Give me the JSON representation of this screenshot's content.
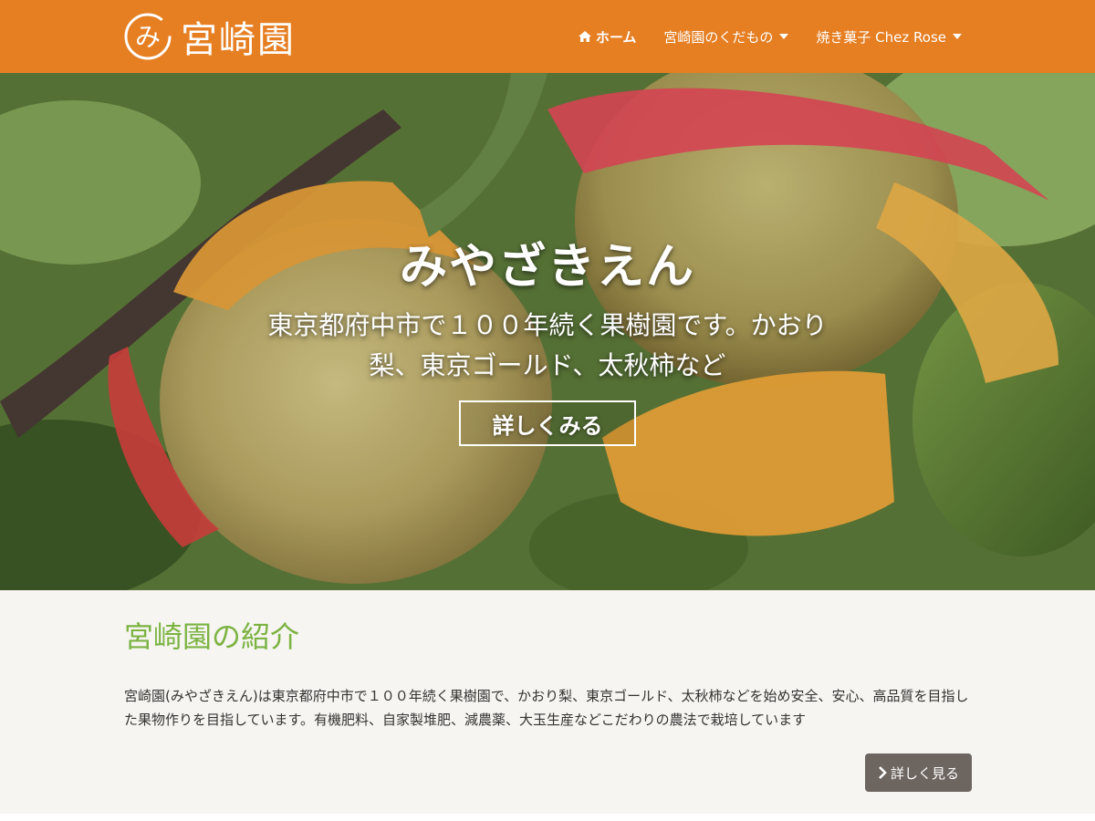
{
  "site": {
    "logo_text": "宮崎園",
    "logo_glyph": "み"
  },
  "nav": {
    "items": [
      {
        "label": "ホーム",
        "icon": "home-icon",
        "active": true
      },
      {
        "label": "宮崎園のくだもの",
        "dropdown": true
      },
      {
        "label": "焼き菓子 Chez Rose",
        "dropdown": true
      }
    ]
  },
  "hero": {
    "title": "みやざきえん",
    "subtitle": "東京都府中市で１００年続く果樹園です。かおり梨、東京ゴールド、太秋柿など",
    "button_label": "詳しくみる"
  },
  "intro": {
    "title": "宮崎園の紹介",
    "text": "宮崎園(みやざきえん)は東京都府中市で１００年続く果樹園で、かおり梨、東京ゴールド、太秋柿などを始め安全、安心、高品質を目指した果物作りを目指しています。有機肥料、自家製堆肥、減農薬、大玉生産などこだわりの農法で栽培しています",
    "button_label": "詳しく見る",
    "button_icon": "chevron-right-icon"
  },
  "colors": {
    "header_bg": "#e67e22",
    "intro_title": "#7cb342",
    "button_bg": "#6d6560",
    "page_bg": "#f6f5f1"
  }
}
